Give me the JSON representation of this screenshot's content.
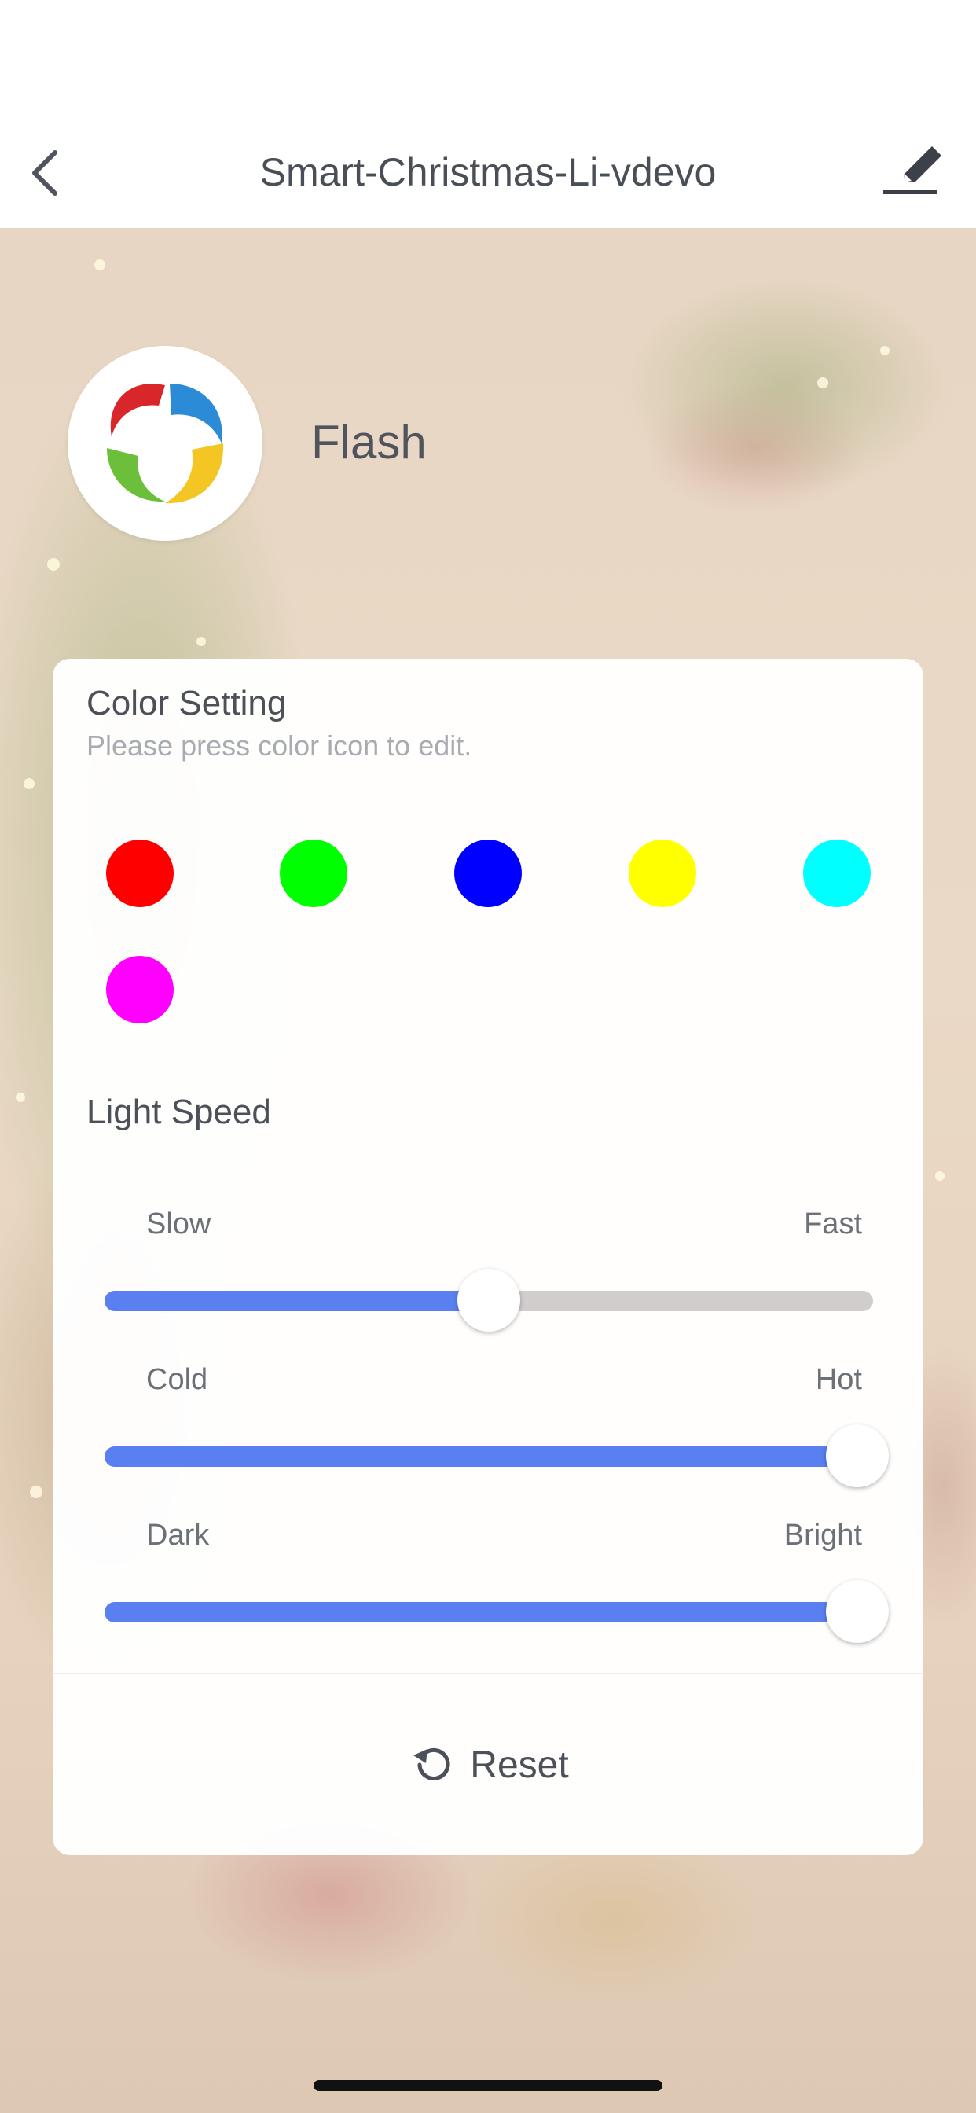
{
  "nav": {
    "title": "Smart-Christmas-Li-vdevo",
    "back_icon": "chevron-left-icon",
    "edit_icon": "pencil-icon"
  },
  "mode": {
    "name": "Flash",
    "logo_icon": "swirl-logo-icon"
  },
  "color_setting": {
    "title": "Color Setting",
    "hint": "Please press color icon to edit.",
    "colors": [
      "#ff0000",
      "#00ff00",
      "#0000ff",
      "#ffff00",
      "#00ffff",
      "#ff00ff"
    ]
  },
  "light_speed": {
    "title": "Light Speed",
    "sliders": [
      {
        "min_label": "Slow",
        "max_label": "Fast",
        "value_percent": 50
      },
      {
        "min_label": "Cold",
        "max_label": "Hot",
        "value_percent": 100
      },
      {
        "min_label": "Dark",
        "max_label": "Bright",
        "value_percent": 100
      }
    ]
  },
  "reset": {
    "label": "Reset",
    "icon": "refresh-icon"
  },
  "theme": {
    "accent": "#5a7ff0",
    "track": "#d1cdcd"
  }
}
